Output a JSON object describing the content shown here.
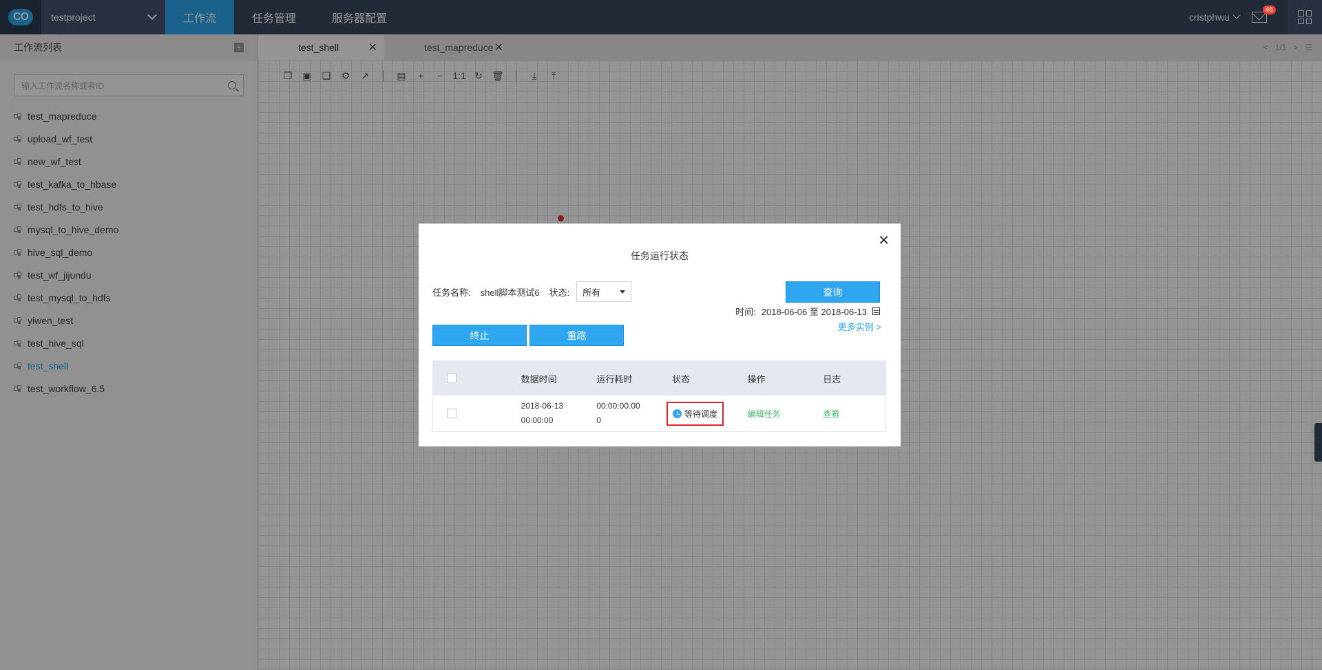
{
  "app": {
    "logo_text": "CO",
    "project": "testproject",
    "nav": [
      "工作流",
      "任务管理",
      "服务器配置"
    ],
    "user": "cristphwu",
    "mail_badge": "46"
  },
  "sidebar": {
    "title": "工作流列表",
    "add_icon": "+",
    "search_placeholder": "输入工作流名称或者ID",
    "items": [
      "test_mapreduce",
      "upload_wf_test",
      "new_wf_test",
      "test_kafka_to_hbase",
      "test_hdfs_to_hive",
      "mysql_to_hive_demo",
      "hive_sql_demo",
      "test_wf_jijundu",
      "test_mysql_to_hdfs",
      "yiwen_test",
      "test_hive_sql",
      "test_shell",
      "test_workflow_6.5"
    ],
    "active_item": "test_shell"
  },
  "tabs": {
    "items": [
      "test_shell",
      "test_mapreduce"
    ],
    "close": "✕",
    "pager": "1/1"
  },
  "toolbar": {
    "icons": [
      "copy-icon",
      "save-icon",
      "paste-icon",
      "settings-icon",
      "export-icon",
      "layout-icon",
      "zoom-in-icon",
      "zoom-out-icon",
      "actual-size-icon",
      "refresh-icon",
      "delete-icon",
      "download-icon",
      "upload-icon"
    ],
    "actual_size_label": "1:1"
  },
  "modal": {
    "close": "✕",
    "title": "任务运行状态",
    "task_name_label": "任务名称:",
    "task_name_value": "shell脚本测试6",
    "status_label": "状态:",
    "status_value": "所有",
    "query_button": "查询",
    "time_label": "时间:",
    "time_value": "2018-06-06 至 2018-06-13",
    "more_link": "更多实例",
    "stop_button": "终止",
    "rerun_button": "重跑",
    "table": {
      "headers": [
        "数据时间",
        "运行耗时",
        "状态",
        "操作",
        "日志"
      ],
      "rows": [
        {
          "data_time_date": "2018-06-13",
          "data_time_time": "00:00:00",
          "duration_line1": "00:00:00.00",
          "duration_line2": "0",
          "status": "等待调度",
          "action": "编辑任务",
          "log": "查看"
        }
      ]
    }
  }
}
